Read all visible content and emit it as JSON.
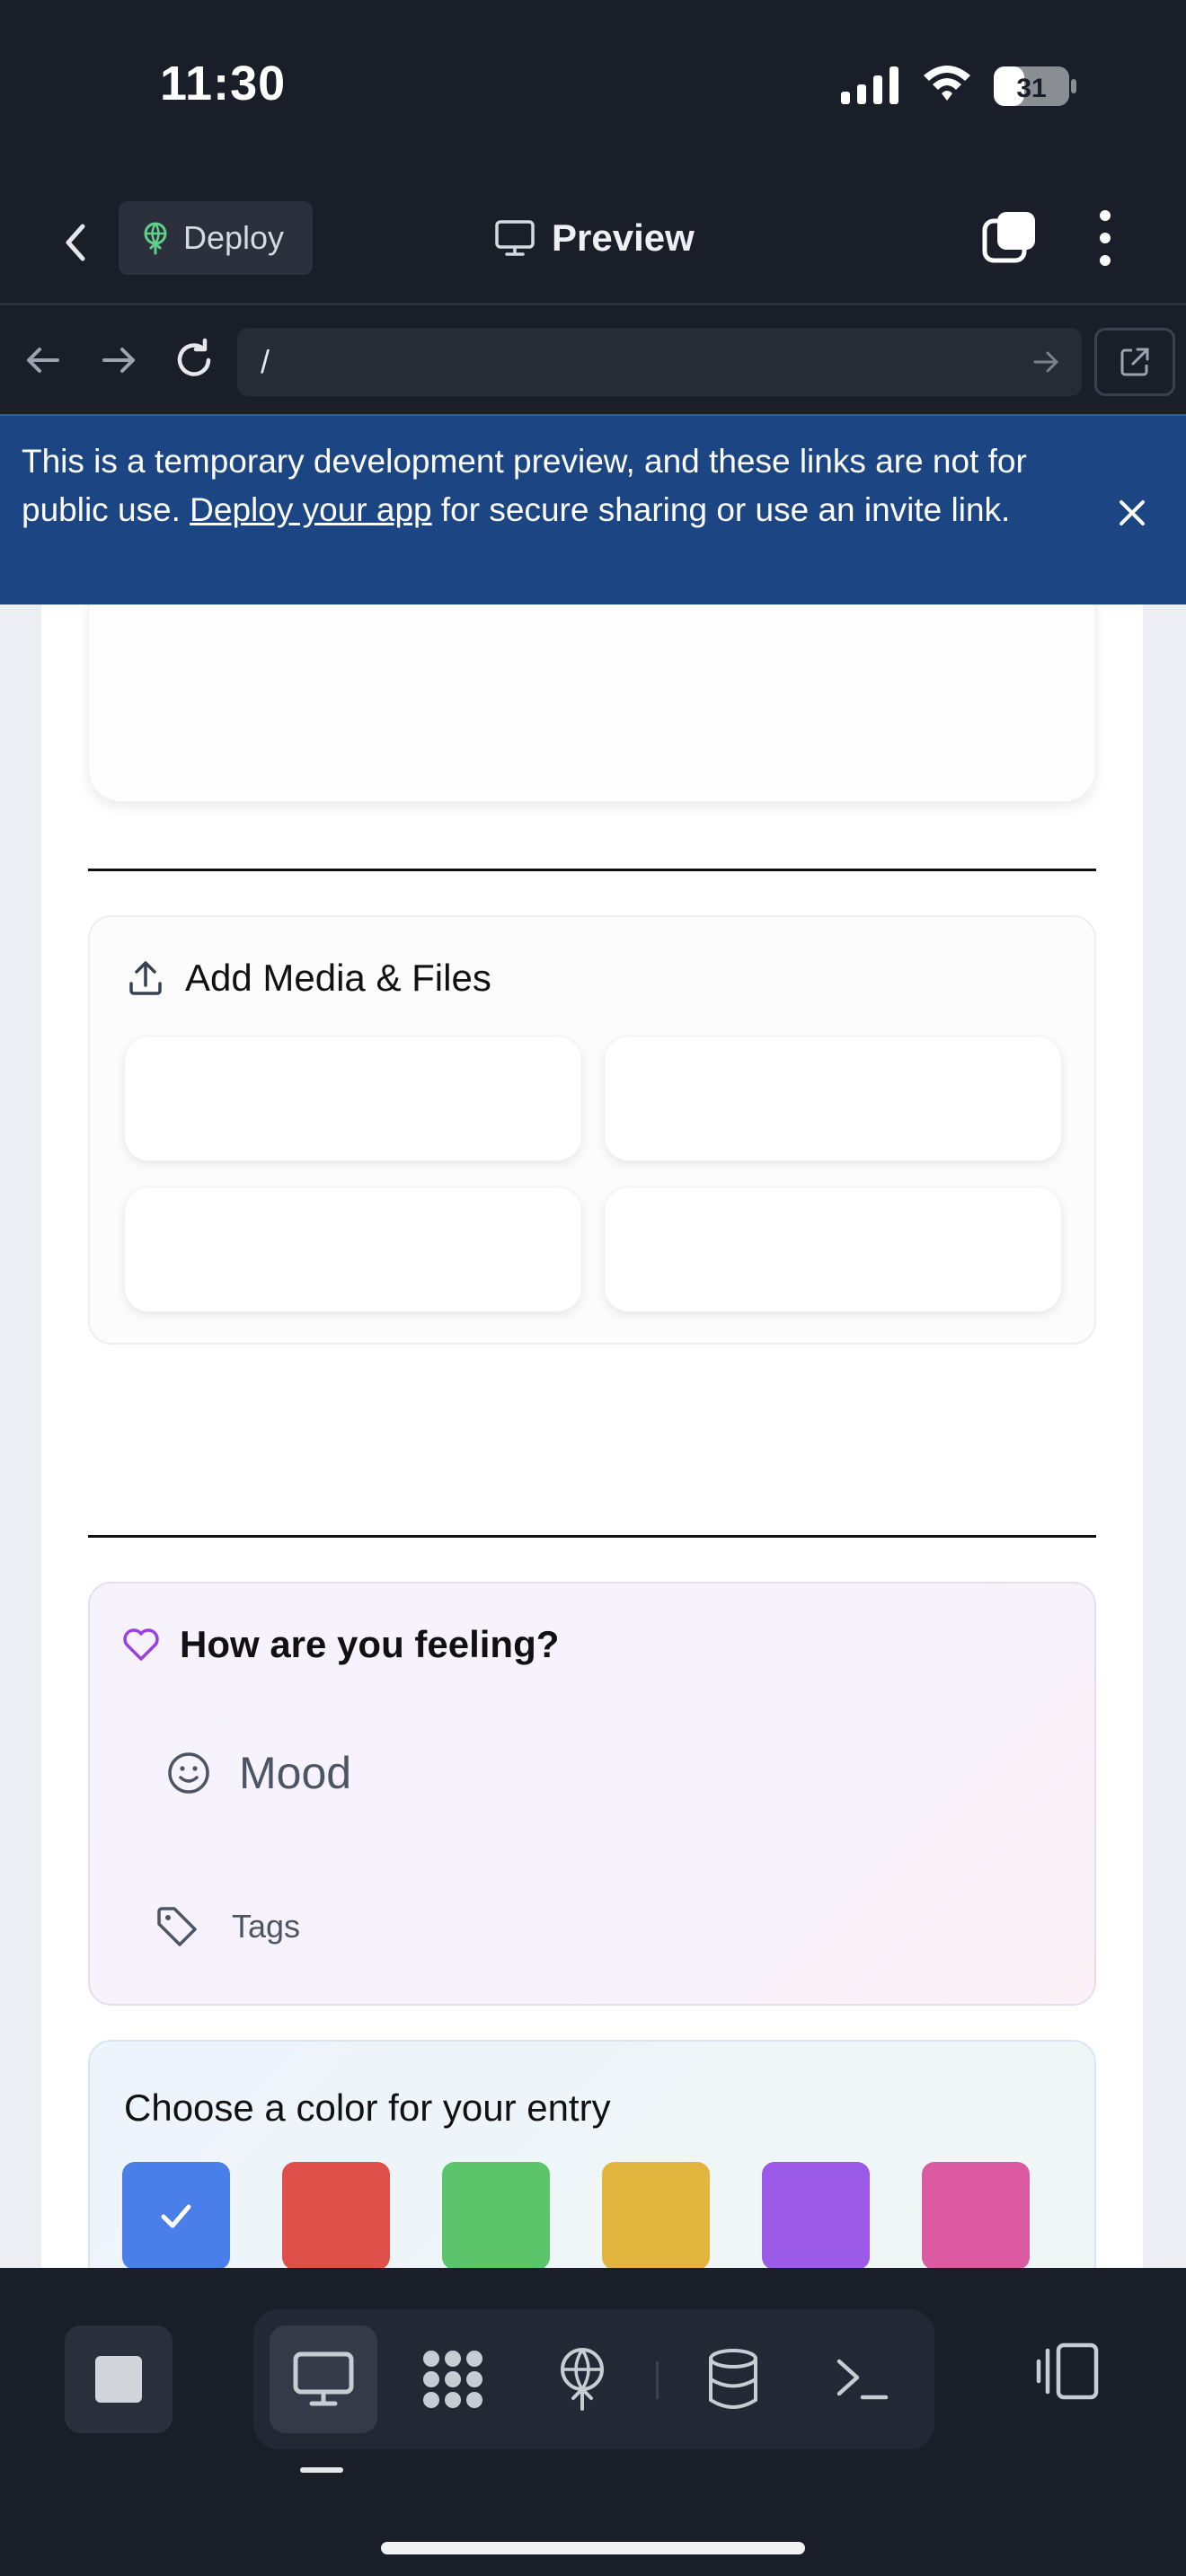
{
  "status_bar": {
    "time": "11:30",
    "battery": "31"
  },
  "app_bar": {
    "deploy_label": "Deploy",
    "title": "Preview"
  },
  "browser": {
    "url": "/"
  },
  "banner": {
    "text_before": "This is a temporary development preview, and these links are not for public use. ",
    "link": "Deploy your app",
    "text_after": " for secure sharing or use an invite link."
  },
  "media": {
    "title": "Add Media & Files"
  },
  "feeling": {
    "title": "How are you feeling?",
    "mood_label": "Mood",
    "tags_label": "Tags"
  },
  "color_picker": {
    "title": "Choose a color for your entry",
    "colors": [
      "#4a7ee8",
      "#e0504a",
      "#5cc46a",
      "#e2b53e",
      "#9b5ae8",
      "#dc5aa0"
    ],
    "selected": 0
  }
}
